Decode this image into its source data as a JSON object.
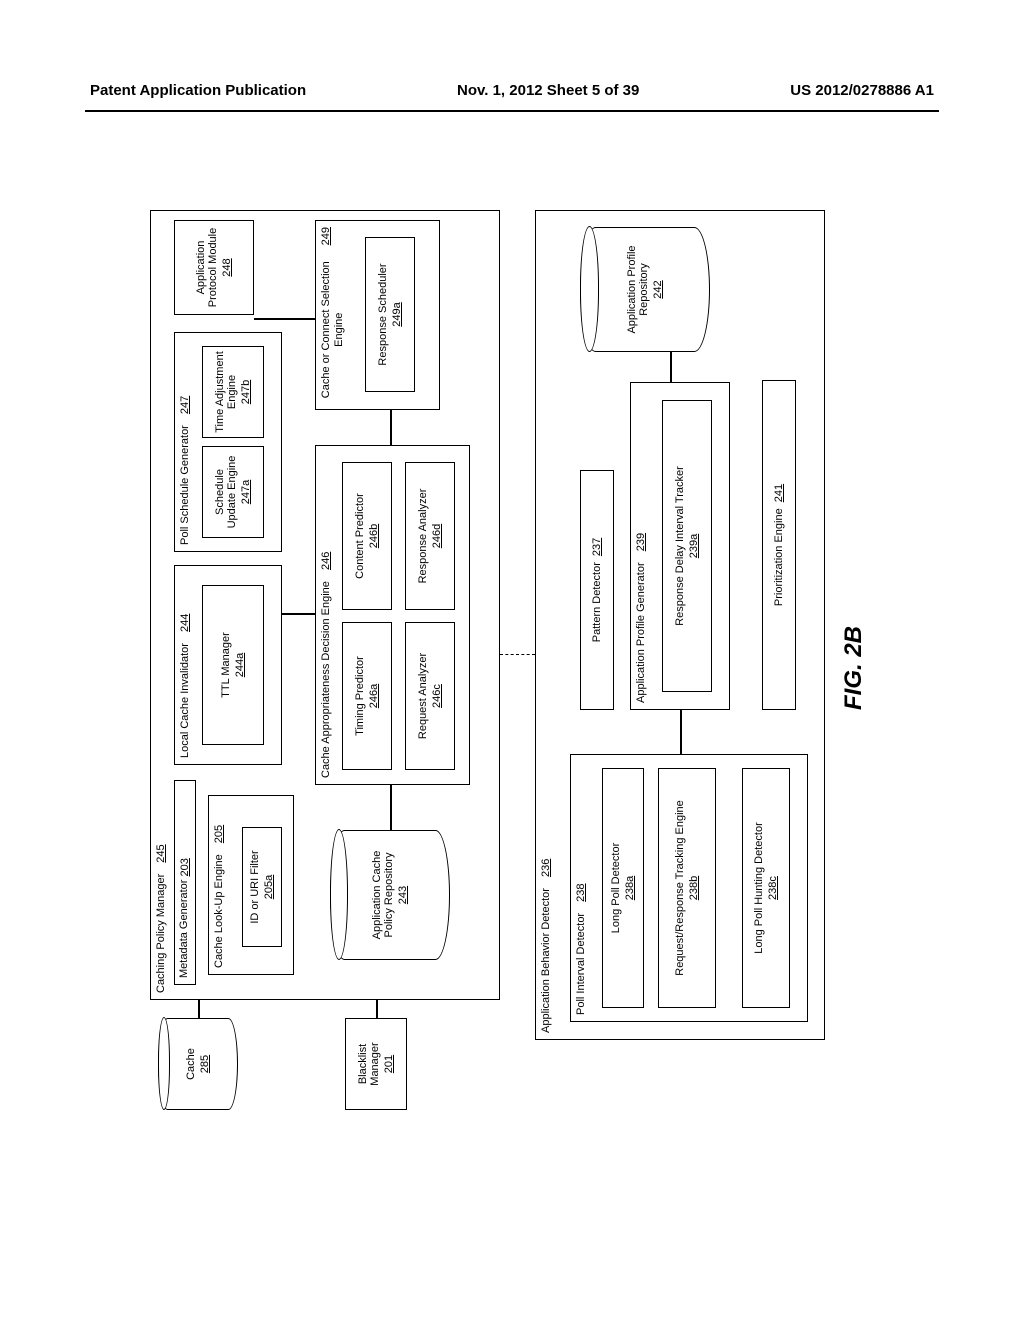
{
  "header": {
    "left": "Patent Application Publication",
    "center": "Nov. 1, 2012  Sheet 5 of 39",
    "right": "US 2012/0278886 A1"
  },
  "figure_label": "FIG. 2B",
  "cache": {
    "label": "Cache",
    "ref": "285"
  },
  "blacklist_manager": {
    "label": "Blacklist Manager",
    "ref": "201"
  },
  "caching_policy_manager": {
    "label": "Caching Policy Manager",
    "ref": "245"
  },
  "metadata_generator": {
    "label": "Metadata Generator",
    "ref": "203"
  },
  "cache_lookup": {
    "label": "Cache Look-Up Engine",
    "ref": "205"
  },
  "id_uri_filter": {
    "label": "ID or URI Filter",
    "ref": "205a"
  },
  "local_cache_invalidator": {
    "label": "Local Cache Invalidator",
    "ref": "244"
  },
  "ttl_manager": {
    "label": "TTL Manager",
    "ref": "244a"
  },
  "poll_schedule_generator": {
    "label": "Poll Schedule Generator",
    "ref": "247"
  },
  "schedule_update_engine": {
    "label": "Schedule Update Engine",
    "ref": "247a"
  },
  "time_adjustment_engine": {
    "label": "Time Adjustment Engine",
    "ref": "247b"
  },
  "app_protocol_module": {
    "label": "Application Protocol Module",
    "ref": "248"
  },
  "app_cache_policy_repo": {
    "label": "Application Cache Policy Repository",
    "ref": "243"
  },
  "cade": {
    "label": "Cache Appropriateness Decision Engine",
    "ref": "246"
  },
  "timing_predictor": {
    "label": "Timing Predictor",
    "ref": "246a"
  },
  "content_predictor": {
    "label": "Content Predictor",
    "ref": "246b"
  },
  "request_analyzer": {
    "label": "Request Analyzer",
    "ref": "246c"
  },
  "response_analyzer_d": {
    "label": "Response Analyzer",
    "ref": "246d"
  },
  "cache_connect_sel": {
    "label": "Cache or Connect Selection Engine",
    "ref": "249"
  },
  "response_scheduler": {
    "label": "Response Scheduler",
    "ref": "249a"
  },
  "app_behavior_detector": {
    "label": "Application Behavior Detector",
    "ref": "236"
  },
  "poll_interval_detector": {
    "label": "Poll Interval Detector",
    "ref": "238"
  },
  "long_poll_detector": {
    "label": "Long Poll Detector",
    "ref": "238a"
  },
  "req_resp_tracking": {
    "label": "Request/Response Tracking Engine",
    "ref": "238b"
  },
  "long_poll_hunting": {
    "label": "Long Poll Hunting Detector",
    "ref": "238c"
  },
  "pattern_detector": {
    "label": "Pattern Detector",
    "ref": "237"
  },
  "app_profile_generator": {
    "label": "Application Profile Generator",
    "ref": "239"
  },
  "resp_delay_tracker": {
    "label": "Response Delay Interval Tracker",
    "ref": "239a"
  },
  "prioritization_engine": {
    "label": "Prioritization Engine",
    "ref": "241"
  },
  "app_profile_repo": {
    "label": "Application Profile Repository",
    "ref": "242"
  }
}
